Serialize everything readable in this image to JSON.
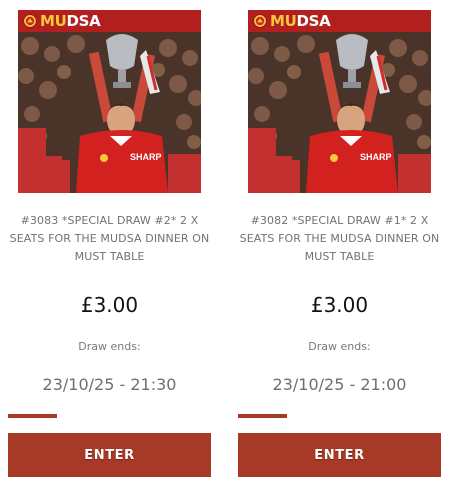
{
  "brand": {
    "prefix": "MU",
    "suffix": "DSA"
  },
  "cards": [
    {
      "title": "#3083 *SPECIAL DRAW #2* 2 X SEATS FOR THE MUDSA DINNER ON MUST TABLE",
      "price": "£3.00",
      "draw_label": "Draw ends:",
      "draw_ends": "23/10/25 - 21:30",
      "progress_percent": 24,
      "button_label": "ENTER"
    },
    {
      "title": "#3082 *SPECIAL DRAW #1* 2 X SEATS FOR THE MUDSA DINNER ON MUST TABLE",
      "price": "£3.00",
      "draw_label": "Draw ends:",
      "draw_ends": "23/10/25 - 21:00",
      "progress_percent": 24,
      "button_label": "ENTER"
    }
  ],
  "colors": {
    "banner": "#b21f1f",
    "accent": "#a63a26",
    "brand_gold": "#f6c83a"
  }
}
